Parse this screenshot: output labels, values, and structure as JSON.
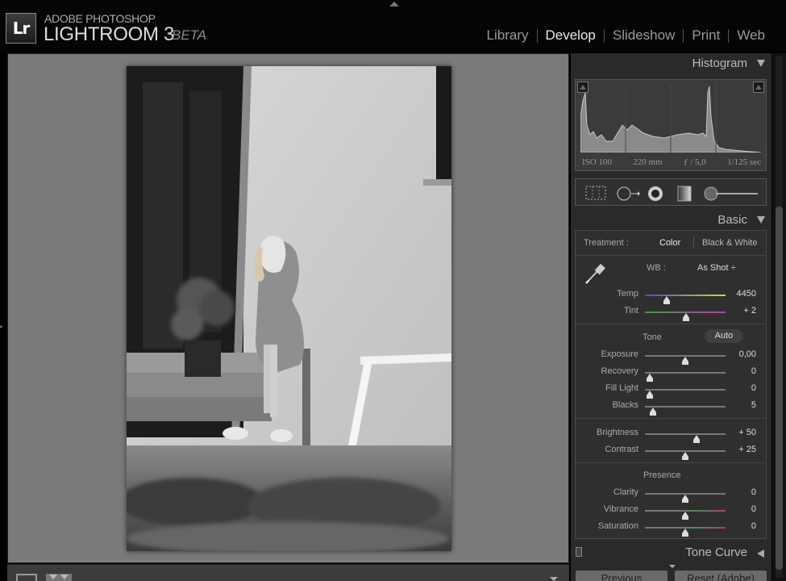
{
  "app": {
    "brand_line1": "ADOBE PHOTOSHOP",
    "brand_line2": "LIGHTROOM 3",
    "brand_beta": "BETA",
    "logo_text": "Lr"
  },
  "modules": [
    {
      "label": "Library",
      "active": false
    },
    {
      "label": "Develop",
      "active": true
    },
    {
      "label": "Slideshow",
      "active": false
    },
    {
      "label": "Print",
      "active": false
    },
    {
      "label": "Web",
      "active": false
    }
  ],
  "histogram": {
    "title": "Histogram",
    "iso": "ISO 100",
    "focal": "220 mm",
    "aperture": "ƒ / 5,0",
    "shutter": "1/125 sec"
  },
  "basic": {
    "title": "Basic",
    "treatment_label": "Treatment :",
    "treatment_color": "Color",
    "treatment_bw": "Black & White",
    "wb_label": "WB :",
    "wb_value": "As Shot ÷",
    "tone_label": "Tone",
    "auto_label": "Auto",
    "presence_label": "Presence",
    "sliders": {
      "temp": {
        "label": "Temp",
        "value": "4450",
        "level": 0.27
      },
      "tint": {
        "label": "Tint",
        "value": "+ 2",
        "level": 0.51
      },
      "exposure": {
        "label": "Exposure",
        "value": "0,00",
        "level": 0.5
      },
      "recovery": {
        "label": "Recovery",
        "value": "0",
        "level": 0.06
      },
      "filllight": {
        "label": "Fill Light",
        "value": "0",
        "level": 0.06
      },
      "blacks": {
        "label": "Blacks",
        "value": "5",
        "level": 0.1
      },
      "brightness": {
        "label": "Brightness",
        "value": "+ 50",
        "level": 0.64
      },
      "contrast": {
        "label": "Contrast",
        "value": "+ 25",
        "level": 0.5
      },
      "clarity": {
        "label": "Clarity",
        "value": "0",
        "level": 0.5
      },
      "vibrance": {
        "label": "Vibrance",
        "value": "0",
        "level": 0.5
      },
      "saturation": {
        "label": "Saturation",
        "value": "0",
        "level": 0.5
      }
    }
  },
  "tone_curve": {
    "title": "Tone Curve"
  },
  "buttons": {
    "previous": "Previous",
    "reset": "Reset (Adobe)"
  },
  "colors": {
    "panel_bg": "#2a2a2a",
    "canvas_bg": "#7a7a7a",
    "active_module": "#e8e8e8"
  }
}
